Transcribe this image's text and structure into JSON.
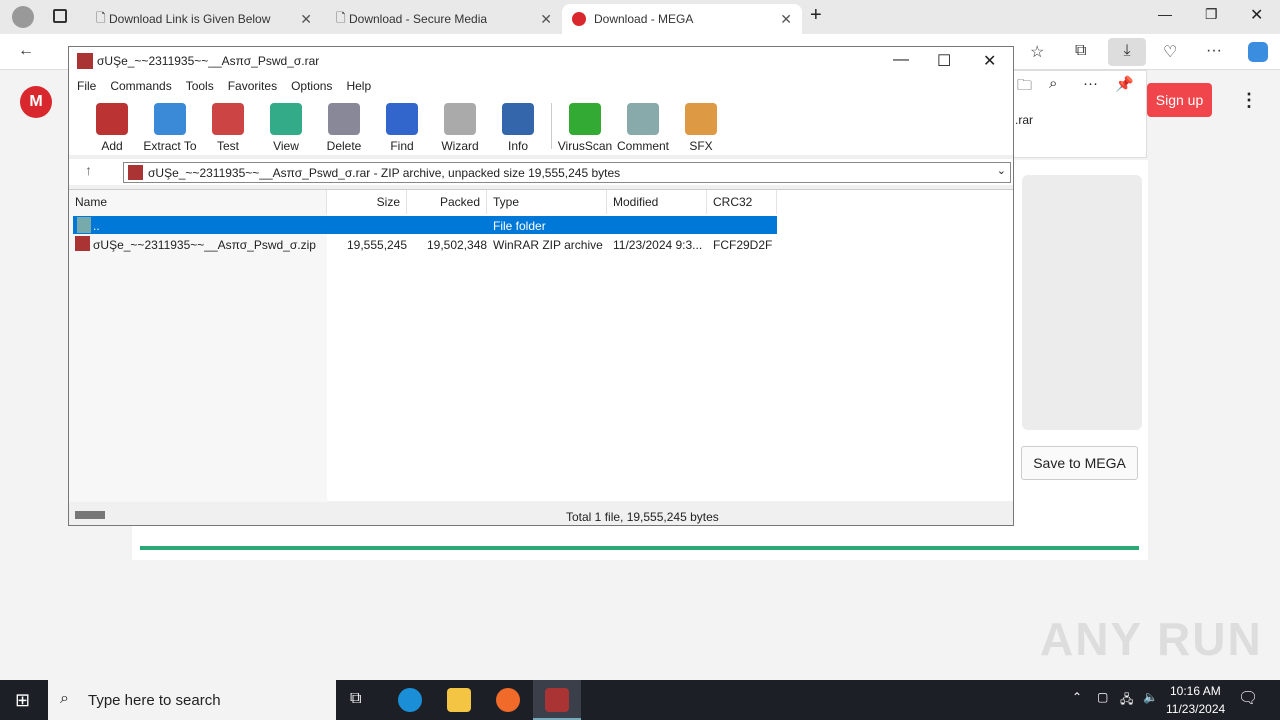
{
  "browser": {
    "tabs": [
      {
        "label": "Download Link is Given Below",
        "icon": "page-icon"
      },
      {
        "label": "Download - Secure Media",
        "icon": "page-icon"
      },
      {
        "label": "Download - MEGA",
        "icon": "mega-icon",
        "active": true
      }
    ],
    "download_panel": {
      "filename_fragment": ".rar"
    }
  },
  "mega": {
    "logo": "M",
    "signup": "Sign up",
    "save": "Save to MEGA",
    "accent": "#f0454b",
    "progress_color": "#2aa876",
    "progress": 100
  },
  "winrar": {
    "title": "σUŞe_~~2311935~~__Asπσ_Pswd_σ.rar",
    "menu": [
      "File",
      "Commands",
      "Tools",
      "Favorites",
      "Options",
      "Help"
    ],
    "tools": [
      {
        "label": "Add",
        "color": "#b33"
      },
      {
        "label": "Extract To",
        "color": "#3a8ad8"
      },
      {
        "label": "Test",
        "color": "#c44"
      },
      {
        "label": "View",
        "color": "#3a8"
      },
      {
        "label": "Delete",
        "color": "#889"
      },
      {
        "label": "Find",
        "color": "#36c"
      },
      {
        "label": "Wizard",
        "color": "#aaa"
      },
      {
        "label": "Info",
        "color": "#36a"
      },
      {
        "label": "VirusScan",
        "color": "#3a3"
      },
      {
        "label": "Comment",
        "color": "#8aa"
      },
      {
        "label": "SFX",
        "color": "#d94"
      }
    ],
    "path": "σUŞe_~~2311935~~__Asπσ_Pswd_σ.rar - ZIP archive, unpacked size 19,555,245 bytes",
    "columns": [
      "Name",
      "Size",
      "Packed",
      "Type",
      "Modified",
      "CRC32"
    ],
    "rows": [
      {
        "name": "..",
        "size": "",
        "packed": "",
        "type": "File folder",
        "modified": "",
        "crc": "",
        "selected": true
      },
      {
        "name": "σUŞe_~~2311935~~__Asπσ_Pswd_σ.zip",
        "size": "19,555,245",
        "packed": "19,502,348",
        "type": "WinRAR ZIP archive",
        "modified": "11/23/2024 9:3...",
        "crc": "FCF29D2F"
      }
    ],
    "status": "Total 1 file, 19,555,245 bytes"
  },
  "taskbar": {
    "search_placeholder": "Type here to search",
    "time": "10:16 AM",
    "date": "11/23/2024"
  },
  "watermark": "ANY RUN"
}
